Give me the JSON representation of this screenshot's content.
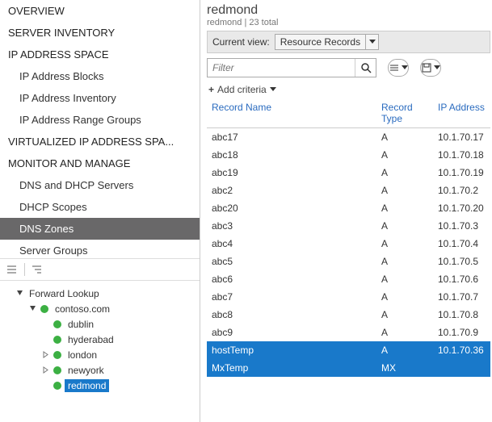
{
  "nav": {
    "items": [
      {
        "label": "OVERVIEW",
        "sub": false
      },
      {
        "label": "SERVER INVENTORY",
        "sub": false
      },
      {
        "label": "IP ADDRESS SPACE",
        "sub": false
      },
      {
        "label": "IP Address Blocks",
        "sub": true
      },
      {
        "label": "IP Address Inventory",
        "sub": true
      },
      {
        "label": "IP Address Range Groups",
        "sub": true
      },
      {
        "label": "VIRTUALIZED IP ADDRESS SPA...",
        "sub": false
      },
      {
        "label": "MONITOR AND MANAGE",
        "sub": false
      },
      {
        "label": "DNS and DHCP Servers",
        "sub": true
      },
      {
        "label": "DHCP Scopes",
        "sub": true
      },
      {
        "label": "DNS Zones",
        "sub": true,
        "selected": true
      },
      {
        "label": "Server Groups",
        "sub": true
      }
    ]
  },
  "tree": {
    "root": {
      "label": "Forward Lookup",
      "expanded": true
    },
    "domain": {
      "label": "contoso.com",
      "expanded": true
    },
    "zones": [
      {
        "label": "dublin",
        "expandable": false
      },
      {
        "label": "hyderabad",
        "expandable": false
      },
      {
        "label": "london",
        "expandable": true
      },
      {
        "label": "newyork",
        "expandable": true
      },
      {
        "label": "redmond",
        "expandable": false,
        "selected": true
      }
    ]
  },
  "header": {
    "title": "redmond",
    "subtitle": "redmond | 23 total",
    "view_label": "Current view:",
    "view_value": "Resource Records"
  },
  "filter": {
    "placeholder": "Filter",
    "criteria_label": "Add criteria"
  },
  "grid": {
    "cols": {
      "name": "Record Name",
      "type": "Record Type",
      "ip": "IP Address"
    },
    "rows": [
      {
        "name": "abc17",
        "type": "A",
        "ip": "10.1.70.17"
      },
      {
        "name": "abc18",
        "type": "A",
        "ip": "10.1.70.18"
      },
      {
        "name": "abc19",
        "type": "A",
        "ip": "10.1.70.19"
      },
      {
        "name": "abc2",
        "type": "A",
        "ip": "10.1.70.2"
      },
      {
        "name": "abc20",
        "type": "A",
        "ip": "10.1.70.20"
      },
      {
        "name": "abc3",
        "type": "A",
        "ip": "10.1.70.3"
      },
      {
        "name": "abc4",
        "type": "A",
        "ip": "10.1.70.4"
      },
      {
        "name": "abc5",
        "type": "A",
        "ip": "10.1.70.5"
      },
      {
        "name": "abc6",
        "type": "A",
        "ip": "10.1.70.6"
      },
      {
        "name": "abc7",
        "type": "A",
        "ip": "10.1.70.7"
      },
      {
        "name": "abc8",
        "type": "A",
        "ip": "10.1.70.8"
      },
      {
        "name": "abc9",
        "type": "A",
        "ip": "10.1.70.9"
      },
      {
        "name": "hostTemp",
        "type": "A",
        "ip": "10.1.70.36",
        "selected": true
      },
      {
        "name": "MxTemp",
        "type": "MX",
        "ip": "",
        "selected": true
      }
    ]
  }
}
